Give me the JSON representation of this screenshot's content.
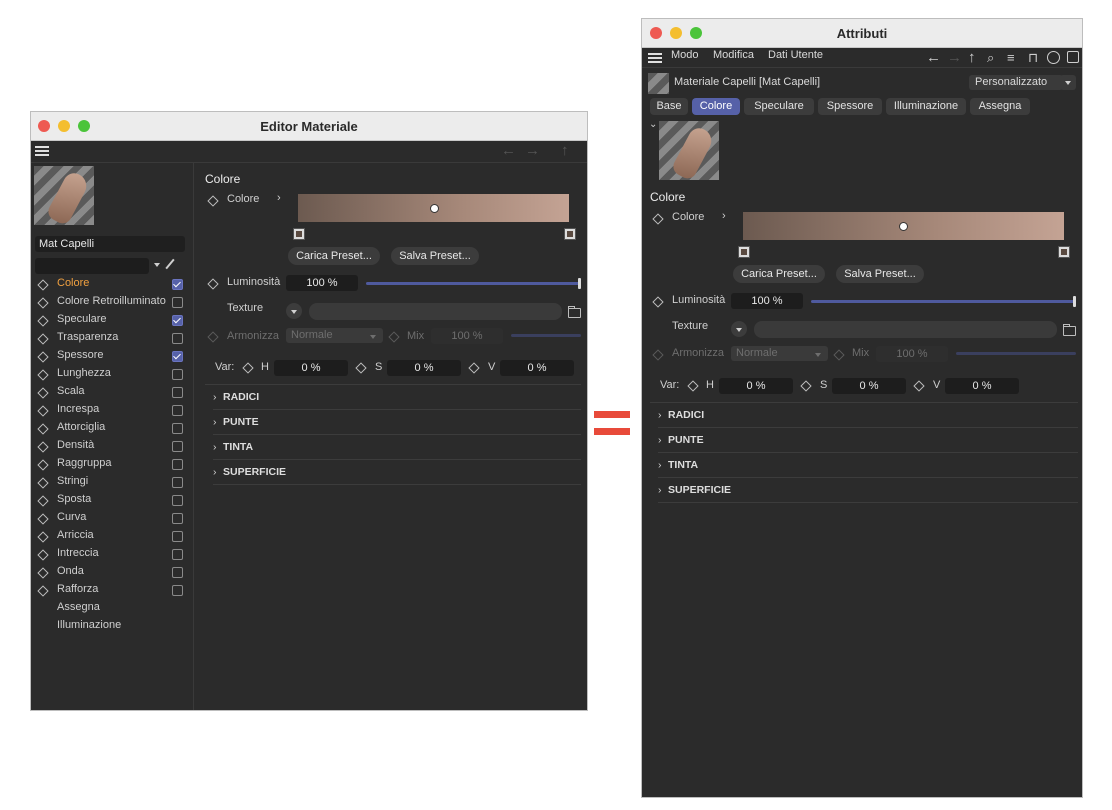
{
  "editor": {
    "title": "Editor Materiale",
    "material_name": "Mat Capelli",
    "channels": [
      {
        "label": "Colore",
        "checked": true,
        "active": true
      },
      {
        "label": "Colore Retroilluminato",
        "checked": false
      },
      {
        "label": "Speculare",
        "checked": true
      },
      {
        "label": "Trasparenza",
        "checked": false
      },
      {
        "label": "Spessore",
        "checked": true
      },
      {
        "label": "Lunghezza",
        "checked": false
      },
      {
        "label": "Scala",
        "checked": false
      },
      {
        "label": "Increspa",
        "checked": false
      },
      {
        "label": "Attorciglia",
        "checked": false
      },
      {
        "label": "Densità",
        "checked": false
      },
      {
        "label": "Raggruppa",
        "checked": false
      },
      {
        "label": "Stringi",
        "checked": false
      },
      {
        "label": "Sposta",
        "checked": false
      },
      {
        "label": "Curva",
        "checked": false
      },
      {
        "label": "Arriccia",
        "checked": false
      },
      {
        "label": "Intreccia",
        "checked": false
      },
      {
        "label": "Onda",
        "checked": false
      },
      {
        "label": "Rafforza",
        "checked": false
      }
    ],
    "extra_items": [
      "Assegna",
      "Illuminazione"
    ]
  },
  "panel": {
    "section_title": "Colore",
    "color_label": "Colore",
    "load_preset": "Carica Preset...",
    "save_preset": "Salva Preset...",
    "brightness_label": "Luminosità",
    "brightness_value": "100 %",
    "brightness_fraction": 1.0,
    "texture_label": "Texture",
    "blend_label": "Armonizza",
    "blend_mode": "Normale",
    "mix_label": "Mix",
    "mix_value": "100 %",
    "var_label": "Var:",
    "h_label": "H",
    "h_value": "0 %",
    "s_label": "S",
    "s_value": "0 %",
    "v_label": "V",
    "v_value": "0 %",
    "sections": [
      "RADICI",
      "PUNTE",
      "TINTA",
      "SUPERFICIE"
    ]
  },
  "attributes": {
    "title": "Attributi",
    "menu": [
      "Modo",
      "Modifica",
      "Dati Utente"
    ],
    "object_name": "Materiale Capelli [Mat Capelli]",
    "mode_dropdown": "Personalizzato",
    "tabs": [
      "Base",
      "Colore",
      "Speculare",
      "Spessore",
      "Illuminazione",
      "Assegna"
    ],
    "active_tab": "Colore"
  },
  "colors": {
    "accent": "#5661a8",
    "active_channel_text": "#f0a040",
    "equals_sign": "#e84a3a"
  }
}
